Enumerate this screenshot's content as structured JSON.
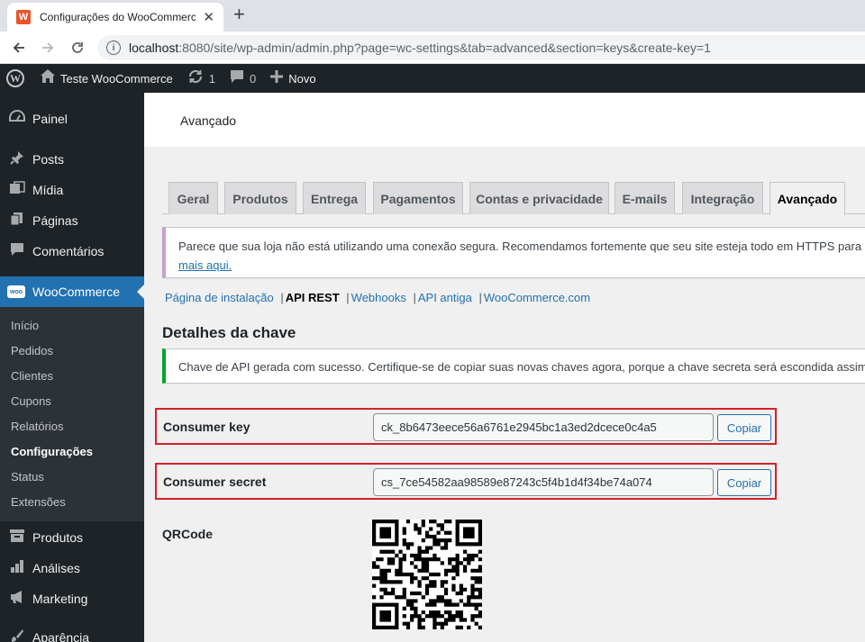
{
  "browser": {
    "tab_title": "Configurações do WooCommerce",
    "url_host": "localhost",
    "url_rest": ":8080/site/wp-admin/admin.php?page=wc-settings&tab=advanced&section=keys&create-key=1",
    "favicon_letter": "W"
  },
  "adminbar": {
    "site_name": "Teste WooCommerce",
    "updates_count": "1",
    "comments_count": "0",
    "new_label": "Novo"
  },
  "sidebar": {
    "items": [
      {
        "label": "Painel",
        "icon": "dashboard-icon"
      },
      {
        "label": "Posts",
        "icon": "pin-icon"
      },
      {
        "label": "Mídia",
        "icon": "media-icon"
      },
      {
        "label": "Páginas",
        "icon": "pages-icon"
      },
      {
        "label": "Comentários",
        "icon": "comments-icon"
      },
      {
        "label": "WooCommerce",
        "icon": "woo-icon"
      },
      {
        "label": "Produtos",
        "icon": "archive-icon"
      },
      {
        "label": "Análises",
        "icon": "chart-icon"
      },
      {
        "label": "Marketing",
        "icon": "megaphone-icon"
      },
      {
        "label": "Aparência",
        "icon": "brush-icon"
      }
    ],
    "woo_badge": "woo",
    "submenu": [
      "Início",
      "Pedidos",
      "Clientes",
      "Cupons",
      "Relatórios",
      "Configurações",
      "Status",
      "Extensões"
    ]
  },
  "header": {
    "title": "Avançado"
  },
  "tabs": [
    "Geral",
    "Produtos",
    "Entrega",
    "Pagamentos",
    "Contas e privacidade",
    "E-mails",
    "Integração",
    "Avançado"
  ],
  "notice_warning": {
    "line1": "Parece que sua loja não está utilizando uma conexão segura. Recomendamos fortemente que seu site esteja todo em HTTPS para ma",
    "link": "mais aqui."
  },
  "sections": [
    "Página de instalação",
    "API REST",
    "Webhooks",
    "API antiga",
    "WooCommerce.com"
  ],
  "section_title": "Detalhes da chave",
  "notice_success": "Chave de API gerada com sucesso. Certifique-se de copiar suas novas chaves agora, porque a chave secreta será escondida assim",
  "fields": {
    "consumer_key_label": "Consumer key",
    "consumer_key_value": "ck_8b6473eece56a6761e2945bc1a3ed2dcece0c4a5",
    "consumer_secret_label": "Consumer secret",
    "consumer_secret_value": "cs_7ce54582aa98589e87243c5f4b1d4f34be74a074",
    "copy_label": "Copiar",
    "qr_label": "QRCode"
  }
}
